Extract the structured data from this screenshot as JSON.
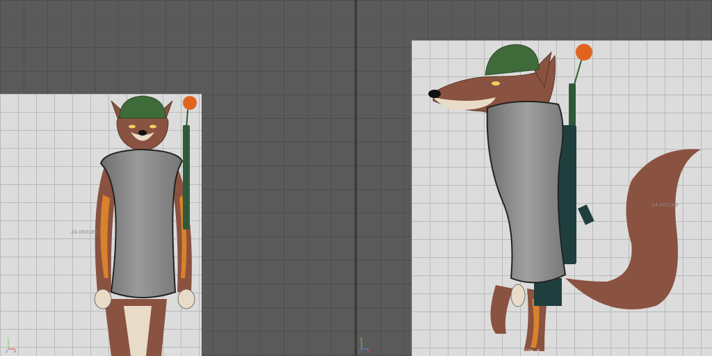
{
  "viewports": {
    "front": {
      "camera_label": "front -Z",
      "measurement": "24.083189"
    },
    "side": {
      "camera_label": "side -X",
      "measurement": "24.083189"
    }
  },
  "axis_gizmo": {
    "y_label": "y",
    "z_label": "z",
    "x_label": "x"
  },
  "colors": {
    "viewport_bg": "#5a5a5a",
    "image_plane_bg": "#dcdcdc",
    "fur_brown": "#8a5240",
    "fur_orange": "#d9822b",
    "helmet_green": "#3f6b3a",
    "rifle_dark": "#1f3f3f",
    "proxy_gray": "#8f8f8f"
  }
}
